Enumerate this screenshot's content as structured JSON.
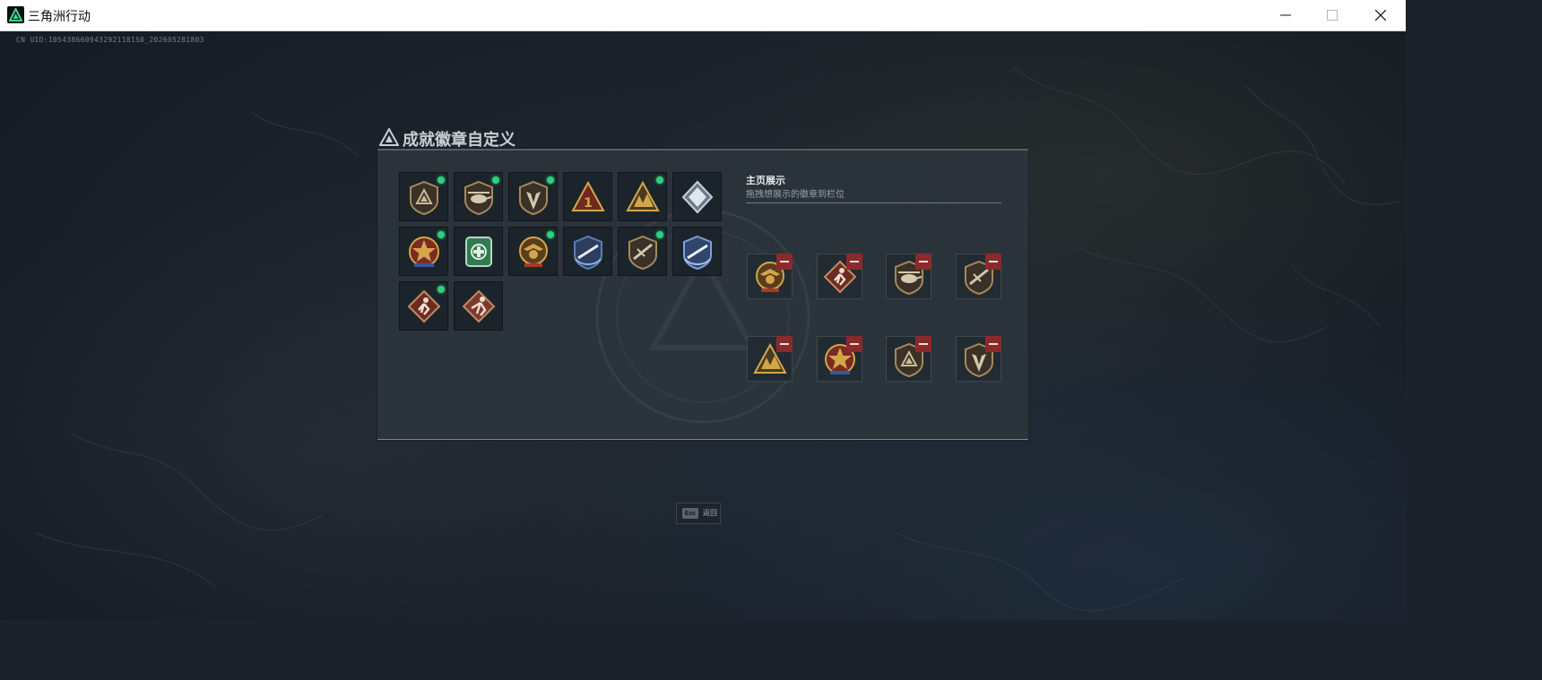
{
  "window": {
    "title": "三角洲行动",
    "minimize_icon": "minimize-icon",
    "maximize_icon": "maximize-icon",
    "close_icon": "close-icon"
  },
  "uid_text": "CN UID:1054386609432921181S0_202605281803",
  "panel": {
    "title": "成就徽章自定义",
    "showcase_title": "主页展示",
    "showcase_subtitle": "拖拽想展示的徽章到栏位"
  },
  "badges": [
    {
      "icon": "shield-triangle-badge",
      "new": true
    },
    {
      "icon": "helicopter-badge",
      "new": true
    },
    {
      "icon": "arrow-shield-badge",
      "new": true
    },
    {
      "icon": "rank-one-triangle-badge",
      "new": false
    },
    {
      "icon": "mountain-soldiers-badge",
      "new": true
    },
    {
      "icon": "diamond-crystal-badge",
      "new": false
    },
    {
      "icon": "star-medal-badge",
      "new": true
    },
    {
      "icon": "medical-cross-badge",
      "new": false
    },
    {
      "icon": "eagle-medal-badge",
      "new": true
    },
    {
      "icon": "rifle-laurel-badge",
      "new": false
    },
    {
      "icon": "crossed-rifle-badge",
      "new": true
    },
    {
      "icon": "rifle-laurel-blue-badge",
      "new": false
    },
    {
      "icon": "runner-diamond-badge",
      "new": true
    },
    {
      "icon": "sprinter-diamond-badge",
      "new": false
    }
  ],
  "showcase_slots": [
    {
      "icon": "eagle-medal-badge"
    },
    {
      "icon": "runner-diamond-badge"
    },
    {
      "icon": "helicopter-badge"
    },
    {
      "icon": "crossed-rifle-badge"
    },
    {
      "icon": "mountain-soldiers-badge"
    },
    {
      "icon": "star-medal-badge"
    },
    {
      "icon": "shield-triangle-badge"
    },
    {
      "icon": "arrow-shield-badge"
    }
  ],
  "esc": {
    "key": "Esc",
    "label": "返回"
  },
  "colors": {
    "new_dot": "#2ed07c",
    "remove_button": "#8a2a2a",
    "bronze": "#a8895a",
    "gold": "#d4a64a",
    "blue": "#5a7fb8",
    "green": "#2f7a4e"
  }
}
